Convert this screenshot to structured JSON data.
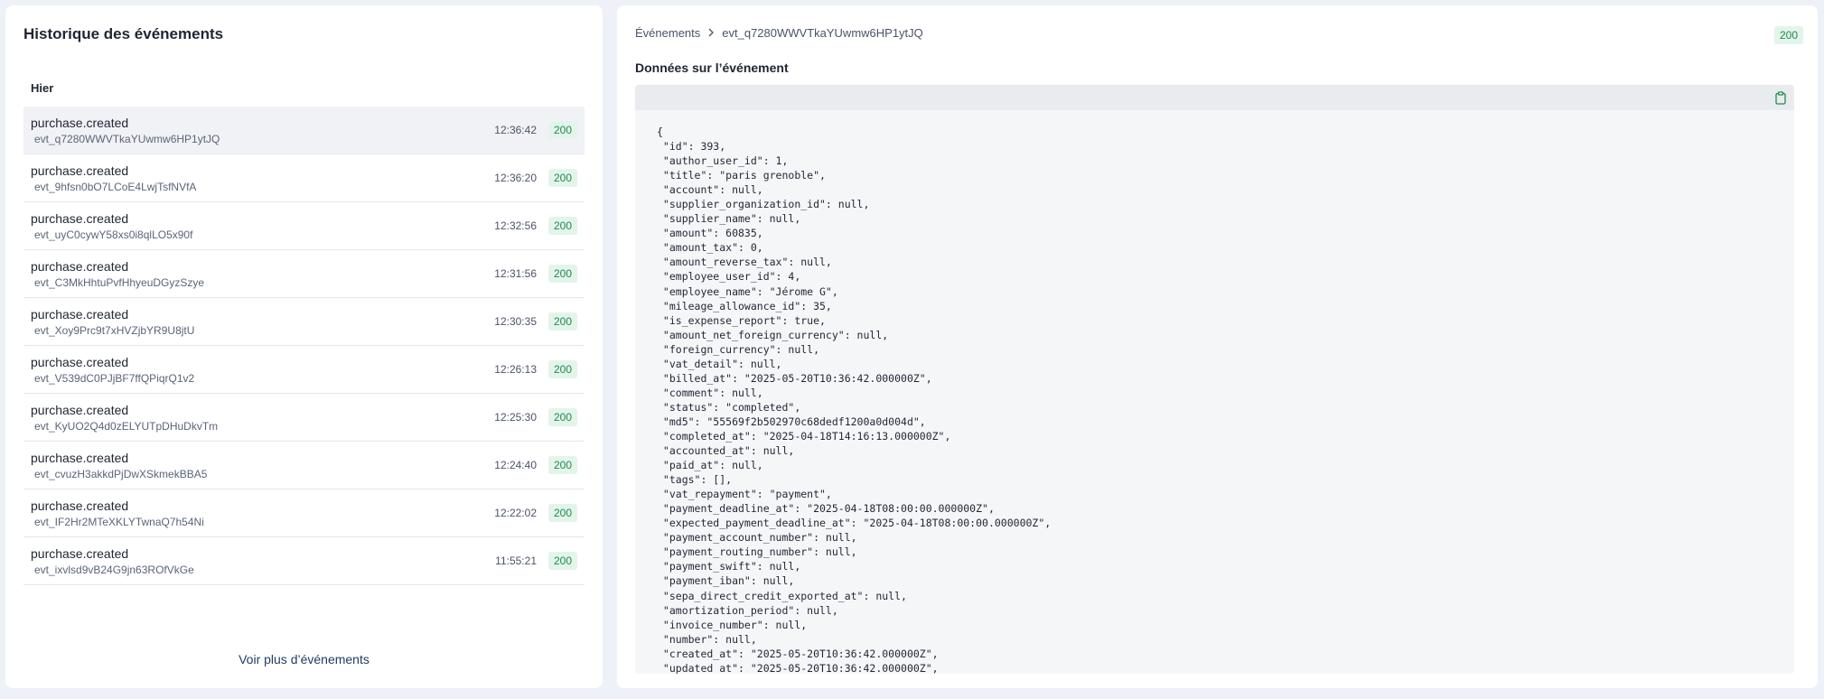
{
  "left": {
    "title": "Historique des événements",
    "group_label": "Hier",
    "more_label": "Voir plus d’événements",
    "events": [
      {
        "name": "purchase.created",
        "id": "evt_q7280WWVTkaYUwmw6HP1ytJQ",
        "time": "12:36:42",
        "status": "200",
        "selected": true
      },
      {
        "name": "purchase.created",
        "id": "evt_9hfsn0bO7LCoE4LwjTsfNVfA",
        "time": "12:36:20",
        "status": "200"
      },
      {
        "name": "purchase.created",
        "id": "evt_uyC0cywY58xs0i8qlLO5x90f",
        "time": "12:32:56",
        "status": "200"
      },
      {
        "name": "purchase.created",
        "id": "evt_C3MkHhtuPvfHhyeuDGyzSzye",
        "time": "12:31:56",
        "status": "200"
      },
      {
        "name": "purchase.created",
        "id": "evt_Xoy9Prc9t7xHVZjbYR9U8jtU",
        "time": "12:30:35",
        "status": "200"
      },
      {
        "name": "purchase.created",
        "id": "evt_V539dC0PJjBF7ffQPiqrQ1v2",
        "time": "12:26:13",
        "status": "200"
      },
      {
        "name": "purchase.created",
        "id": "evt_KyUO2Q4d0zELYUTpDHuDkvTm",
        "time": "12:25:30",
        "status": "200"
      },
      {
        "name": "purchase.created",
        "id": "evt_cvuzH3akkdPjDwXSkmekBBA5",
        "time": "12:24:40",
        "status": "200"
      },
      {
        "name": "purchase.created",
        "id": "evt_IF2Hr2MTeXKLYTwnaQ7h54Ni",
        "time": "12:22:02",
        "status": "200"
      },
      {
        "name": "purchase.created",
        "id": "evt_ixvlsd9vB24G9jn63ROfVkGe",
        "time": "11:55:21",
        "status": "200"
      }
    ]
  },
  "right": {
    "breadcrumb_root": "Événements",
    "breadcrumb_current": "evt_q7280WWVTkaYUwmw6HP1ytJQ",
    "status": "200",
    "section_title": "Données sur l’événement",
    "code_lines": [
      "{",
      " \"id\": 393,",
      " \"author_user_id\": 1,",
      " \"title\": \"paris grenoble\",",
      " \"account\": null,",
      " \"supplier_organization_id\": null,",
      " \"supplier_name\": null,",
      " \"amount\": 60835,",
      " \"amount_tax\": 0,",
      " \"amount_reverse_tax\": null,",
      " \"employee_user_id\": 4,",
      " \"employee_name\": \"Jérome G\",",
      " \"mileage_allowance_id\": 35,",
      " \"is_expense_report\": true,",
      " \"amount_net_foreign_currency\": null,",
      " \"foreign_currency\": null,",
      " \"vat_detail\": null,",
      " \"billed_at\": \"2025-05-20T10:36:42.000000Z\",",
      " \"comment\": null,",
      " \"status\": \"completed\",",
      " \"md5\": \"55569f2b502970c68dedf1200a0d004d\",",
      " \"completed_at\": \"2025-04-18T14:16:13.000000Z\",",
      " \"accounted_at\": null,",
      " \"paid_at\": null,",
      " \"tags\": [],",
      " \"vat_repayment\": \"payment\",",
      " \"payment_deadline_at\": \"2025-04-18T08:00:00.000000Z\",",
      " \"expected_payment_deadline_at\": \"2025-04-18T08:00:00.000000Z\",",
      " \"payment_account_number\": null,",
      " \"payment_routing_number\": null,",
      " \"payment_swift\": null,",
      " \"payment_iban\": null,",
      " \"sepa_direct_credit_exported_at\": null,",
      " \"amortization_period\": null,",
      " \"invoice_number\": null,",
      " \"number\": null,",
      " \"created_at\": \"2025-05-20T10:36:42.000000Z\",",
      " \"updated_at\": \"2025-05-20T10:36:42.000000Z\","
    ]
  }
}
